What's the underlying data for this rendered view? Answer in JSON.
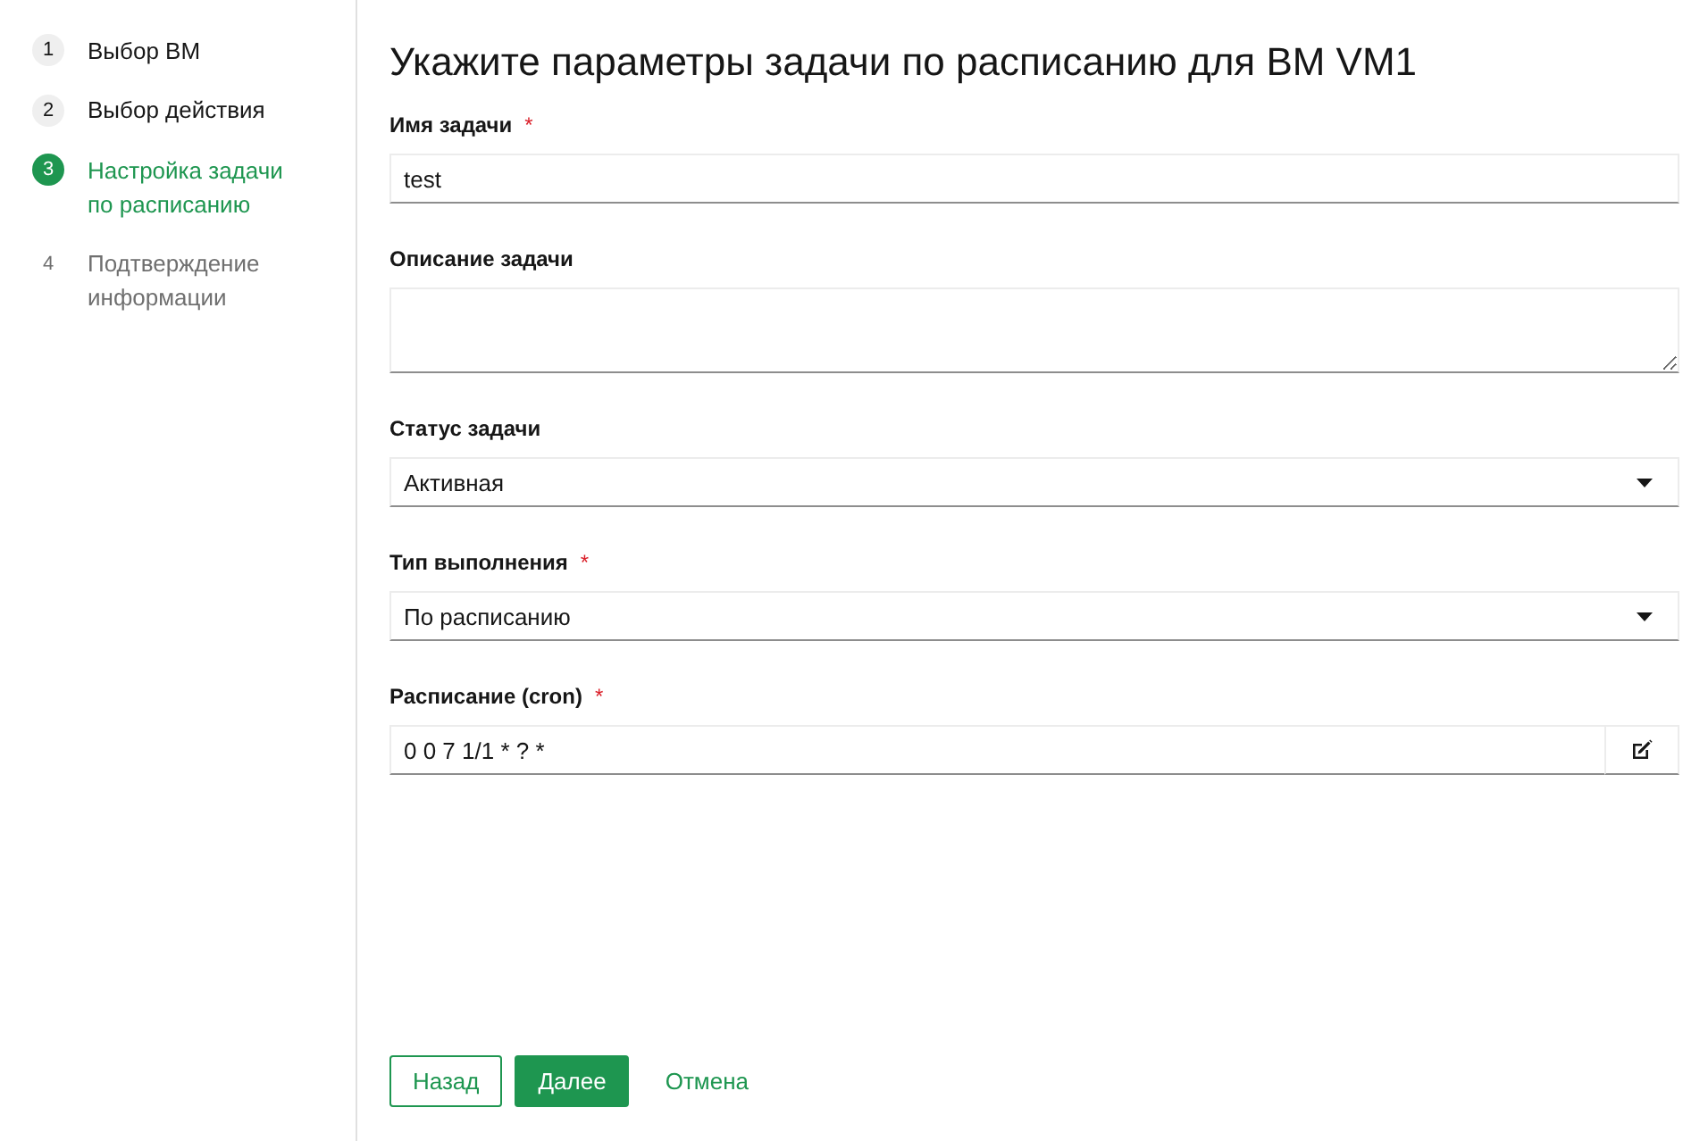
{
  "sidebar": {
    "steps": [
      {
        "number": "1",
        "label": "Выбор ВМ",
        "completed": true,
        "selected": false
      },
      {
        "number": "2",
        "label": "Выбор действия",
        "completed": true,
        "selected": false
      },
      {
        "number": "3",
        "label": "Настройка задачи по расписанию",
        "completed": false,
        "selected": true
      },
      {
        "number": "4",
        "label": "Подтверждение информации",
        "completed": false,
        "selected": false
      }
    ]
  },
  "form": {
    "title": "Укажите параметры задачи по расписанию для ВМ VM1",
    "fields": [
      {
        "kind": "text",
        "label": "Имя задачи",
        "required_mark": "*",
        "value": "test"
      },
      {
        "kind": "textarea",
        "label": "Описание задачи"
      },
      {
        "kind": "select",
        "label": "Статус задачи",
        "value": "Активная"
      },
      {
        "kind": "select",
        "label": "Тип выполнения",
        "required_mark": "*",
        "value": "По расписанию"
      },
      {
        "kind": "cron",
        "label": "Расписание (cron)",
        "required_mark": "*",
        "value": "0 0 7 1/1 * ? *"
      }
    ]
  },
  "buttons": [
    {
      "label": "Назад",
      "kind": "outline"
    },
    {
      "label": "Далее",
      "kind": "primary"
    },
    {
      "label": "Отмена",
      "kind": "link"
    }
  ]
}
